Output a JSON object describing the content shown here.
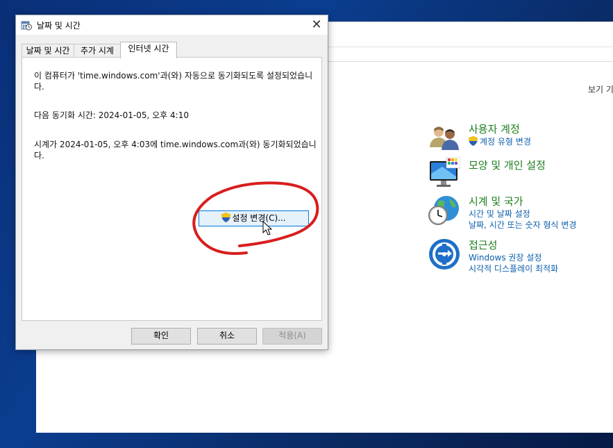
{
  "dialog": {
    "title": "날짜 및 시간",
    "close_symbol": "✕",
    "tabs": [
      {
        "label": "날짜 및 시간"
      },
      {
        "label": "추가 시계"
      },
      {
        "label": "인터넷 시간"
      }
    ],
    "active_tab": "인터넷 시간",
    "sync_info_line1": "이 컴퓨터가 'time.windows.com'과(와) 자동으로 동기화되도록 설정되었습니다.",
    "next_sync": "다음 동기화 시간: 2024-01-05, 오후 4:10",
    "last_sync": "시계가 2024-01-05, 오후 4:03에 time.windows.com과(와) 동기화되었습니다.",
    "change_settings_label": "설정 변경(C)...",
    "ok_label": "확인",
    "cancel_label": "취소",
    "apply_label": "적용(A)"
  },
  "control_panel": {
    "view_by": "보기 기",
    "categories": [
      {
        "title": "사용자 계정",
        "icon": "users-icon",
        "links": [
          "계정 유형 변경"
        ],
        "shield_link": true
      },
      {
        "title": "모양 및 개인 설정",
        "icon": "monitor-palette-icon",
        "links": []
      },
      {
        "title": "시계 및 국가",
        "icon": "globe-clock-icon",
        "links": [
          "시간 및 날짜 설정",
          "날짜, 시간 또는 숫자 형식 변경"
        ]
      },
      {
        "title": "접근성",
        "icon": "accessibility-icon",
        "links": [
          "Windows 권장 설정",
          "시각적 디스플레이 최적화"
        ]
      }
    ]
  },
  "colors": {
    "category_title": "#1e7d1e",
    "link": "#0b5fad",
    "annotation_red": "#d81e1e",
    "focus_blue": "#0078d7"
  }
}
